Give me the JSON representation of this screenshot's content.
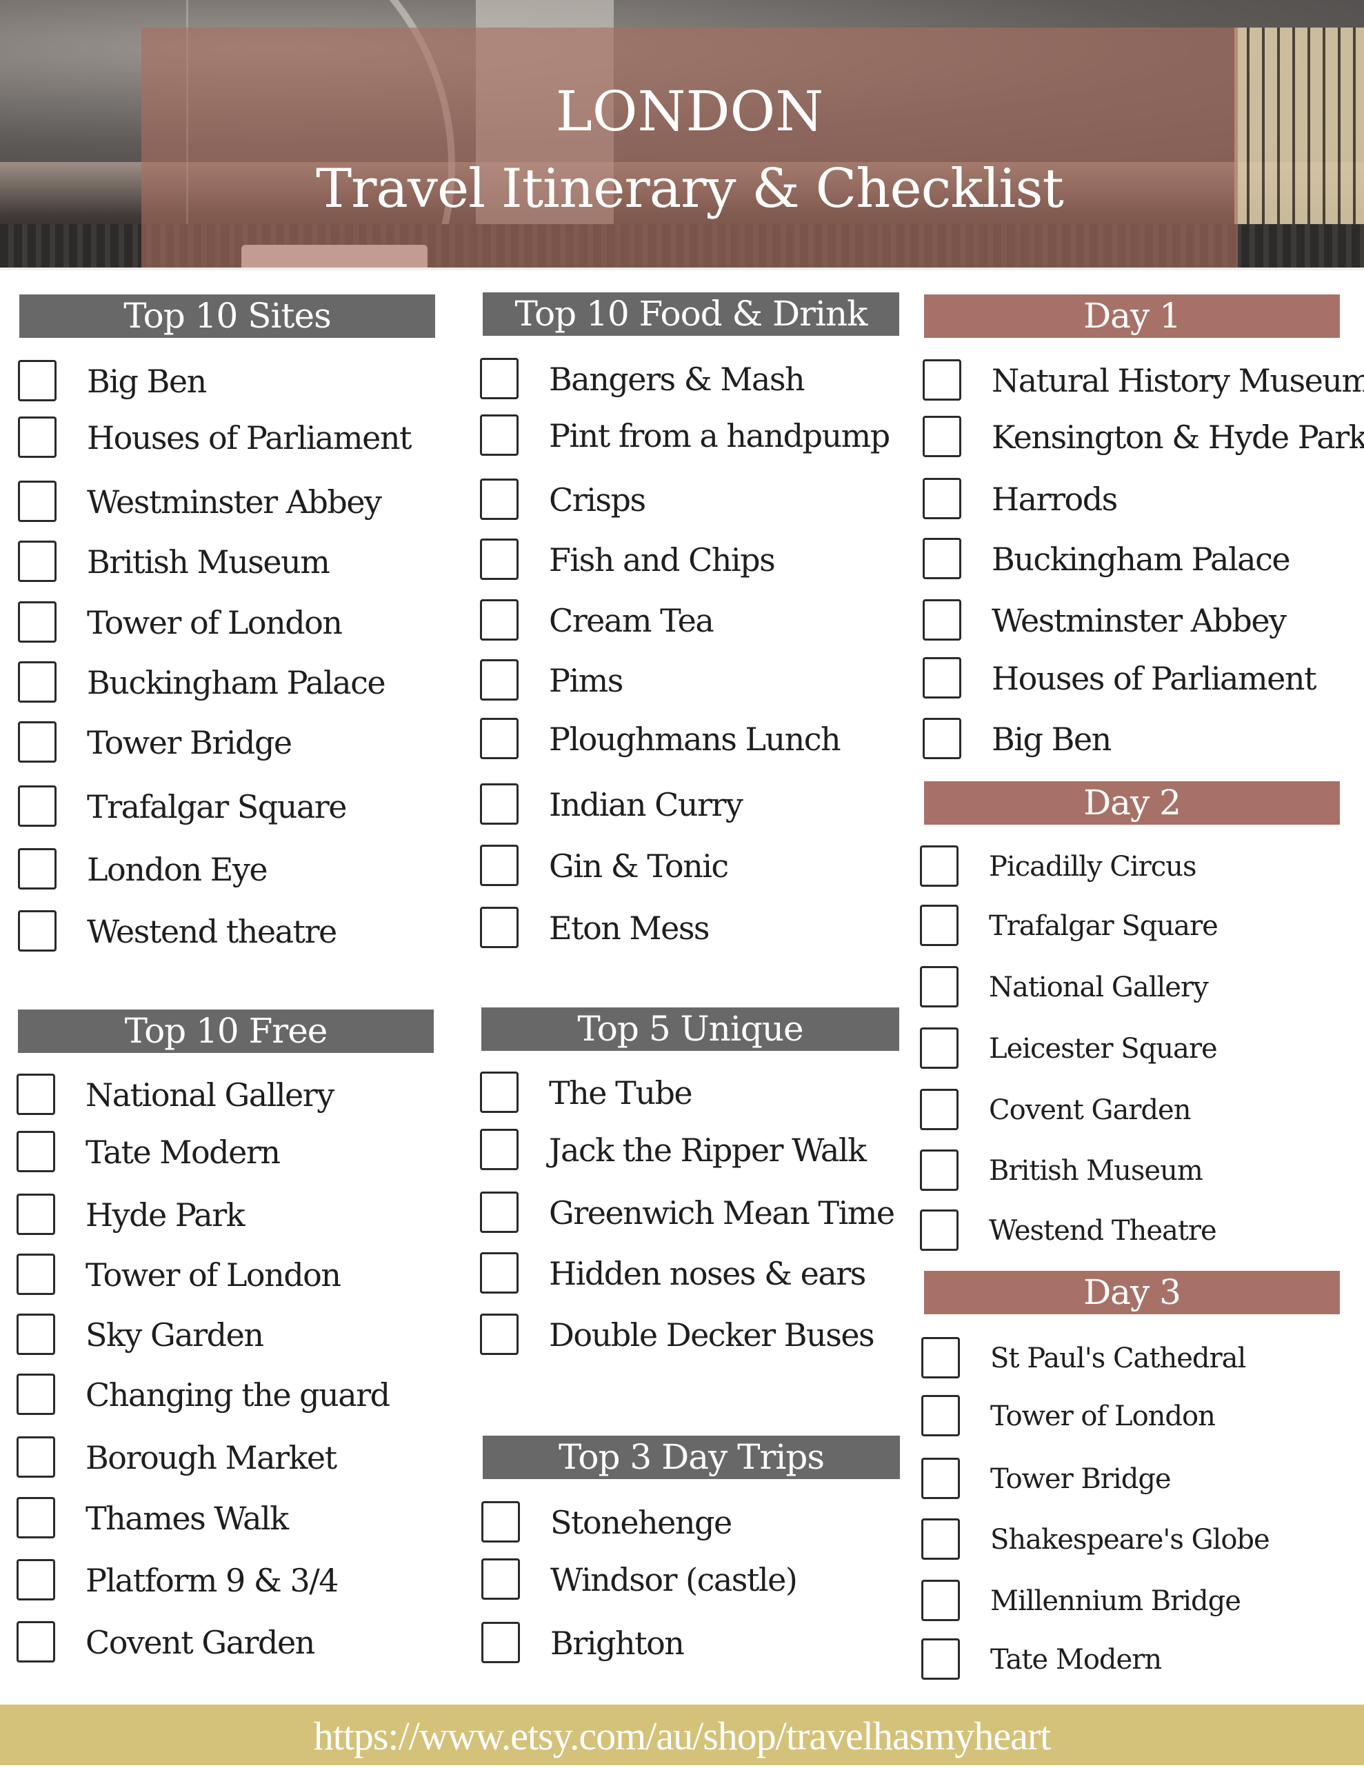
{
  "header": {
    "title_line1": "LONDON",
    "title_line2": "Travel Itinerary & Checklist"
  },
  "colors": {
    "section_gray": "#686868",
    "section_rose": "#a87167",
    "footer_gold": "#d4c27a",
    "overlay_rose": "#aa6e5f"
  },
  "sections": {
    "top_sites": {
      "title": "Top 10 Sites",
      "items": [
        "Big Ben",
        "Houses of Parliament",
        "Westminster Abbey",
        "British Museum",
        "Tower of London",
        "Buckingham Palace",
        "Tower Bridge",
        "Trafalgar Square",
        "London Eye",
        "Westend theatre"
      ]
    },
    "top_food": {
      "title": "Top 10 Food & Drink",
      "items": [
        "Bangers & Mash",
        "Pint from a handpump",
        "Crisps",
        "Fish and Chips",
        "Cream Tea",
        "Pims",
        "Ploughmans Lunch",
        "Indian Curry",
        "Gin & Tonic",
        "Eton Mess"
      ]
    },
    "day1": {
      "title": "Day 1",
      "items": [
        "Natural History Museum",
        "Kensington & Hyde Parks",
        "Harrods",
        "Buckingham Palace",
        "Westminster Abbey",
        "Houses of Parliament",
        "Big Ben"
      ]
    },
    "day2": {
      "title": "Day 2",
      "items": [
        "Picadilly Circus",
        "Trafalgar Square",
        "National Gallery",
        "Leicester Square",
        "Covent Garden",
        "British Museum",
        "Westend Theatre"
      ]
    },
    "day3": {
      "title": "Day 3",
      "items": [
        "St Paul's Cathedral",
        "Tower of London",
        "Tower Bridge",
        "Shakespeare's Globe",
        "Millennium Bridge",
        "Tate Modern"
      ]
    },
    "top_free": {
      "title": "Top 10 Free",
      "items": [
        "National Gallery",
        "Tate Modern",
        "Hyde Park",
        "Tower of London",
        "Sky Garden",
        "Changing the guard",
        "Borough Market",
        "Thames Walk",
        "Platform 9 & 3/4",
        "Covent Garden"
      ]
    },
    "top_unique": {
      "title": "Top 5 Unique",
      "items": [
        "The Tube",
        "Jack the Ripper Walk",
        "Greenwich Mean Time",
        "Hidden noses & ears",
        "Double Decker Buses"
      ]
    },
    "day_trips": {
      "title": "Top 3 Day Trips",
      "items": [
        "Stonehenge",
        "Windsor (castle)",
        "Brighton"
      ]
    }
  },
  "footer": {
    "url": "https://www.etsy.com/au/shop/travelhasmyheart"
  }
}
